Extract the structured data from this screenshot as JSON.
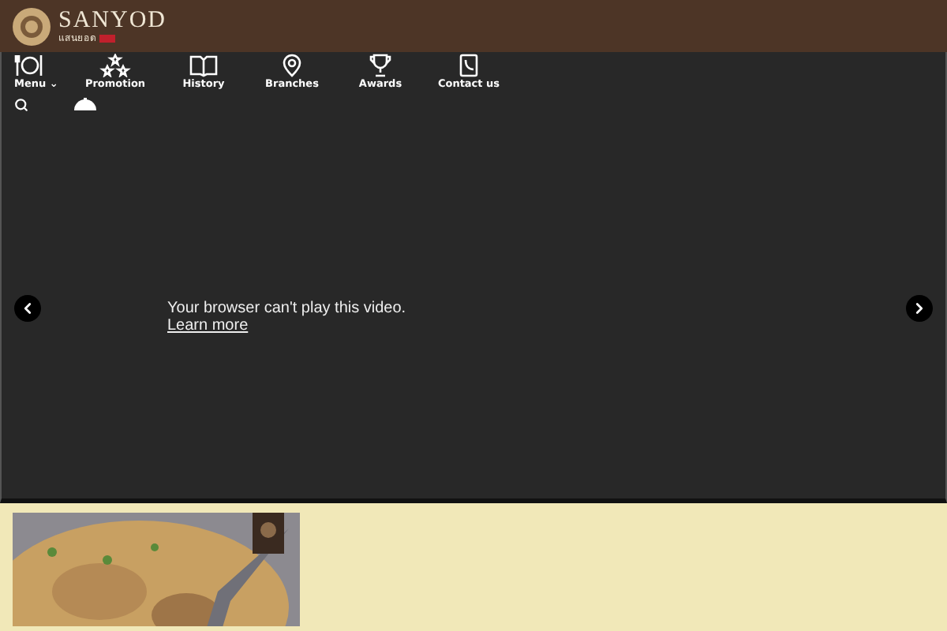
{
  "brand": {
    "name": "SANYOD",
    "subtitle": "แสนยอด"
  },
  "nav": [
    {
      "label": "Menu",
      "kind": "menu",
      "dropdown": "⌄"
    },
    {
      "label": "Promotion",
      "kind": "stars"
    },
    {
      "label": "History",
      "kind": "book"
    },
    {
      "label": "Branches",
      "kind": "pin"
    },
    {
      "label": "Awards",
      "kind": "trophy"
    },
    {
      "label": "Contact us",
      "kind": "phone"
    }
  ],
  "video": {
    "message": "Your browser can't play this video.",
    "link": "Learn more"
  }
}
